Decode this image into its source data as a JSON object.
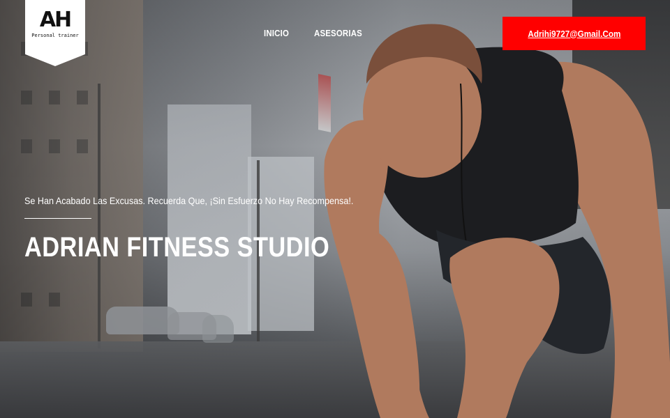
{
  "logo": {
    "mark": "AH",
    "subtitle": "Personal trainer"
  },
  "nav": {
    "items": [
      {
        "label": "INICIO"
      },
      {
        "label": "ASESORIAS"
      }
    ]
  },
  "header": {
    "email_button": "Adrihi9727@Gmail.Com",
    "accent_color": "#ff0000"
  },
  "hero": {
    "tagline": "Se Han Acabado Las Excusas. Recuerda Que, ¡Sin Esfuerzo No Hay Recompensa!.",
    "title": "ADRIAN FITNESS STUDIO"
  }
}
